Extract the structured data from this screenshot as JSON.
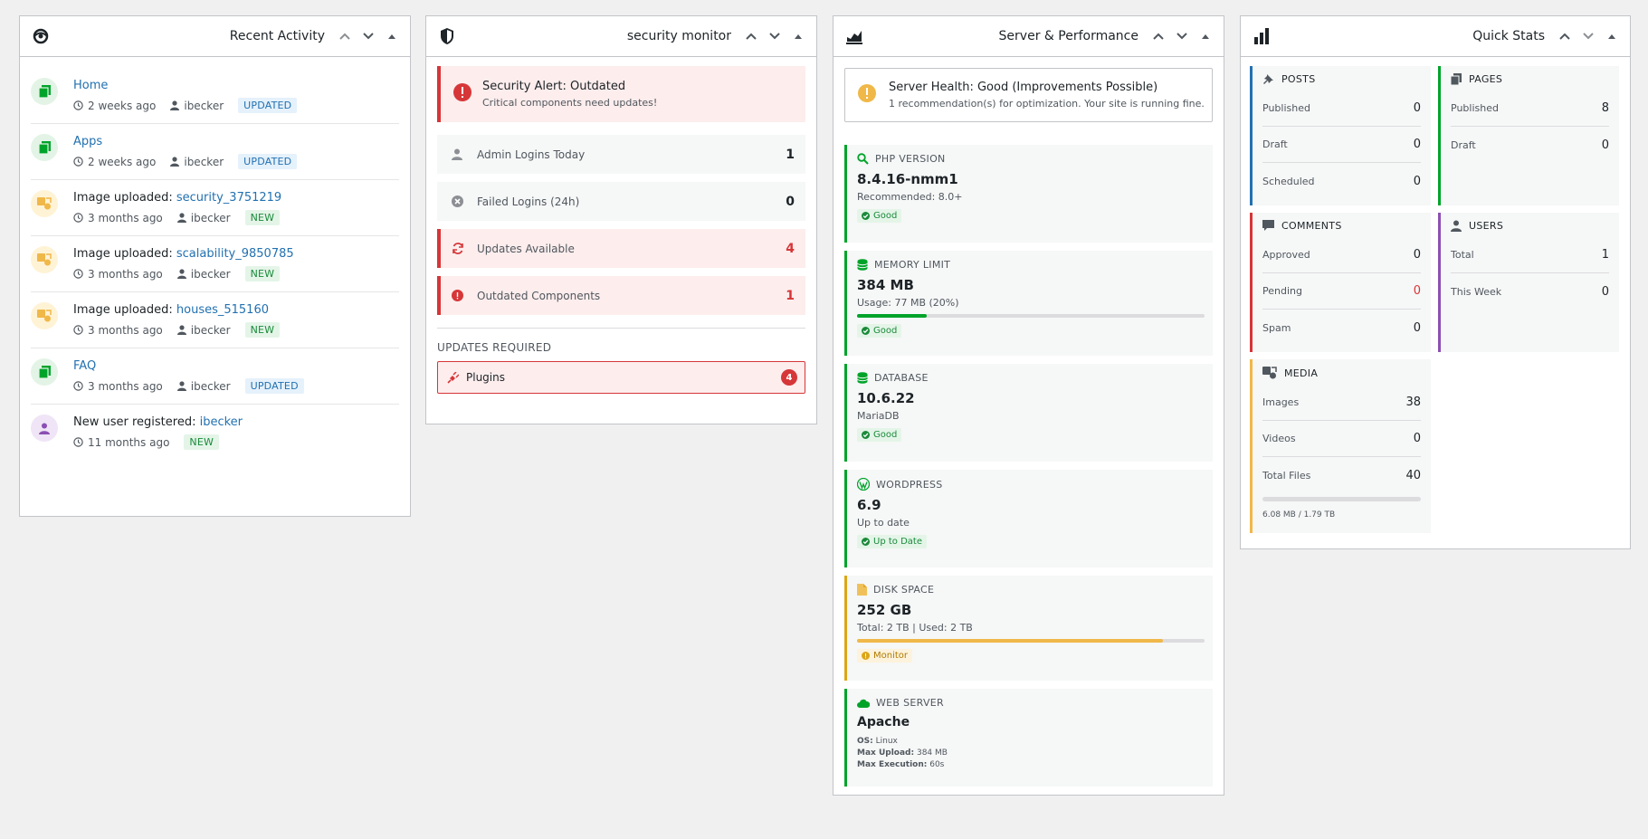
{
  "recent_activity": {
    "title": "Recent Activity",
    "items": [
      {
        "prefix": "",
        "link": "Home",
        "time": "2 weeks ago",
        "user": "ibecker",
        "badge": "UPDATED",
        "kind": "page"
      },
      {
        "prefix": "",
        "link": "Apps",
        "time": "2 weeks ago",
        "user": "ibecker",
        "badge": "UPDATED",
        "kind": "page"
      },
      {
        "prefix": "Image uploaded: ",
        "link": "security_3751219",
        "time": "3 months ago",
        "user": "ibecker",
        "badge": "NEW",
        "kind": "media"
      },
      {
        "prefix": "Image uploaded: ",
        "link": "scalability_9850785",
        "time": "3 months ago",
        "user": "ibecker",
        "badge": "NEW",
        "kind": "media"
      },
      {
        "prefix": "Image uploaded: ",
        "link": "houses_515160",
        "time": "3 months ago",
        "user": "ibecker",
        "badge": "NEW",
        "kind": "media"
      },
      {
        "prefix": "",
        "link": "FAQ",
        "time": "3 months ago",
        "user": "ibecker",
        "badge": "UPDATED",
        "kind": "page"
      },
      {
        "prefix": "New user registered: ",
        "link": "ibecker",
        "time": "11 months ago",
        "user": "",
        "badge": "NEW",
        "kind": "user"
      }
    ]
  },
  "security": {
    "title": "security monitor",
    "alert_title": "Security Alert: Outdated",
    "alert_text": "Critical components need updates!",
    "rows": [
      {
        "label": "Admin Logins Today",
        "value": "1"
      },
      {
        "label": "Failed Logins (24h)",
        "value": "0"
      },
      {
        "label": "Updates Available",
        "value": "4"
      },
      {
        "label": "Outdated Components",
        "value": "1"
      }
    ],
    "updates_heading": "UPDATES REQUIRED",
    "plugins_label": "Plugins",
    "plugins_count": "4"
  },
  "server": {
    "title": "Server & Performance",
    "health_title": "Server Health: Good (Improvements Possible)",
    "health_text": "1 recommendation(s) for optimization. Your site is running fine.",
    "php": {
      "label": "PHP VERSION",
      "value": "8.4.16-nmm1",
      "sub": "Recommended: 8.0+",
      "status": "Good"
    },
    "memory": {
      "label": "MEMORY LIMIT",
      "value": "384 MB",
      "sub": "Usage: 77 MB (20%)",
      "status": "Good",
      "usage_percent": 20
    },
    "database": {
      "label": "DATABASE",
      "value": "10.6.22",
      "sub": "MariaDB",
      "status": "Good"
    },
    "wordpress": {
      "label": "WORDPRESS",
      "value": "6.9",
      "sub": "Up to date",
      "status": "Up to Date"
    },
    "disk": {
      "label": "DISK SPACE",
      "value": "252 GB",
      "sub": "Total: 2 TB | Used: 2 TB",
      "status": "Monitor",
      "usage_percent": 88
    },
    "webserver": {
      "label": "WEB SERVER",
      "value": "Apache",
      "os_key": "OS:",
      "os_val": "Linux",
      "upload_key": "Max Upload:",
      "upload_val": "384 MB",
      "exec_key": "Max Execution:",
      "exec_val": "60s"
    }
  },
  "quick_stats": {
    "title": "Quick Stats",
    "posts": {
      "label": "POSTS",
      "published_label": "Published",
      "published": "0",
      "draft_label": "Draft",
      "draft": "0",
      "scheduled_label": "Scheduled",
      "scheduled": "0"
    },
    "pages": {
      "label": "PAGES",
      "published_label": "Published",
      "published": "8",
      "draft_label": "Draft",
      "draft": "0"
    },
    "comments": {
      "label": "COMMENTS",
      "approved_label": "Approved",
      "approved": "0",
      "pending_label": "Pending",
      "pending": "0",
      "spam_label": "Spam",
      "spam": "0"
    },
    "users": {
      "label": "USERS",
      "total_label": "Total",
      "total": "1",
      "week_label": "This Week",
      "week": "0"
    },
    "media": {
      "label": "MEDIA",
      "images_label": "Images",
      "images": "38",
      "videos_label": "Videos",
      "videos": "0",
      "total_label": "Total Files",
      "total": "40",
      "storage": "6.08 MB / 1.79 TB"
    }
  },
  "colors": {
    "green": "#00a32a",
    "red": "#d63638",
    "blue": "#2271b1",
    "yellow": "#dba617",
    "purple": "#8c4fb3"
  }
}
